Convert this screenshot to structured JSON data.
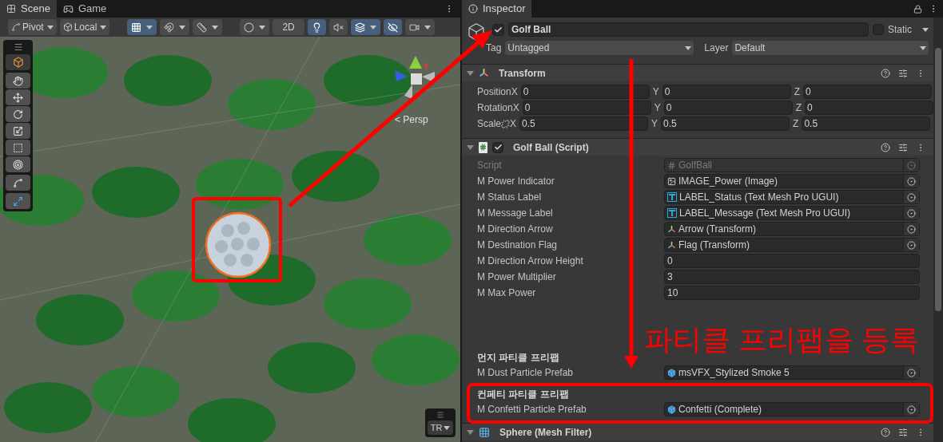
{
  "scene_panel": {
    "tabs": [
      {
        "label": "Scene",
        "kind": "scene",
        "selected": true
      },
      {
        "label": "Game",
        "kind": "game",
        "selected": false
      }
    ],
    "toolbar": {
      "pivot": "Pivot",
      "space": "Local",
      "toggles": [
        {
          "kind": "grid_snap",
          "on": true
        },
        {
          "kind": "increment_snap",
          "on": false
        },
        {
          "kind": "grid",
          "on": false
        },
        {
          "kind": "draw_mode",
          "on": false
        },
        {
          "kind": "mode_2d",
          "label": "2D",
          "on": false
        },
        {
          "kind": "lighting",
          "on": true
        },
        {
          "kind": "audio",
          "on": false
        },
        {
          "kind": "effects",
          "on": true
        },
        {
          "kind": "visibility",
          "on": true
        },
        {
          "kind": "camera",
          "on": false
        }
      ]
    },
    "view_label": "< Persp",
    "overlay_button": "TR"
  },
  "inspector": {
    "title": "Inspector",
    "object": {
      "active": true,
      "name": "Golf Ball",
      "static": false,
      "static_label": "Static",
      "tag_label": "Tag",
      "tag": "Untagged",
      "layer_label": "Layer",
      "layer": "Default"
    },
    "transform": {
      "title": "Transform",
      "expanded": true,
      "rows": [
        {
          "label": "Position",
          "linked": false,
          "values": [
            {
              "axis": "X",
              "value": "0"
            },
            {
              "axis": "Y",
              "value": "0"
            },
            {
              "axis": "Z",
              "value": "0"
            }
          ]
        },
        {
          "label": "Rotation",
          "linked": false,
          "values": [
            {
              "axis": "X",
              "value": "0"
            },
            {
              "axis": "Y",
              "value": "0"
            },
            {
              "axis": "Z",
              "value": "0"
            }
          ]
        },
        {
          "label": "Scale",
          "linked": true,
          "values": [
            {
              "axis": "X",
              "value": "0.5"
            },
            {
              "axis": "Y",
              "value": "0.5"
            },
            {
              "axis": "Z",
              "value": "0.5"
            }
          ]
        }
      ]
    },
    "script": {
      "title": "Golf Ball (Script)",
      "enabled": true,
      "expanded": true,
      "fields": [
        {
          "kind": "script",
          "label": "Script",
          "value": "GolfBall",
          "disabled": true
        },
        {
          "kind": "image",
          "label": "M Power Indicator",
          "value": "IMAGE_Power (Image)",
          "disabled": false
        },
        {
          "kind": "text",
          "label": "M Status Label",
          "value": "LABEL_Status (Text Mesh Pro UGUI)",
          "disabled": false
        },
        {
          "kind": "text",
          "label": "M Message Label",
          "value": "LABEL_Message (Text Mesh Pro UGUI)",
          "disabled": false
        },
        {
          "kind": "transform",
          "label": "M Direction Arrow",
          "value": "Arrow (Transform)",
          "disabled": false
        },
        {
          "kind": "transform",
          "label": "M Destination Flag",
          "value": "Flag (Transform)",
          "disabled": false
        },
        {
          "kind": "number",
          "label": "M Direction Arrow Height",
          "value": "0",
          "disabled": false
        },
        {
          "kind": "number",
          "label": "M Power Multiplier",
          "value": "3",
          "disabled": false
        },
        {
          "kind": "number",
          "label": "M Max Power",
          "value": "10",
          "disabled": false
        }
      ],
      "sections": [
        {
          "header": "먼지 파티클 프리팹",
          "fields": [
            {
              "kind": "prefab",
              "label": "M Dust Particle Prefab",
              "value": "msVFX_Stylized Smoke 5",
              "disabled": false
            }
          ]
        },
        {
          "header": "컨페티 파티클 프리팹",
          "fields": [
            {
              "kind": "prefab",
              "label": "M Confetti Particle Prefab",
              "value": "Confetti (Complete)",
              "disabled": false
            }
          ]
        }
      ]
    },
    "mesh_filter": {
      "title": "Sphere (Mesh Filter)",
      "expanded": true
    }
  },
  "annotation": {
    "text": "파티클 프리팹을 등록"
  }
}
